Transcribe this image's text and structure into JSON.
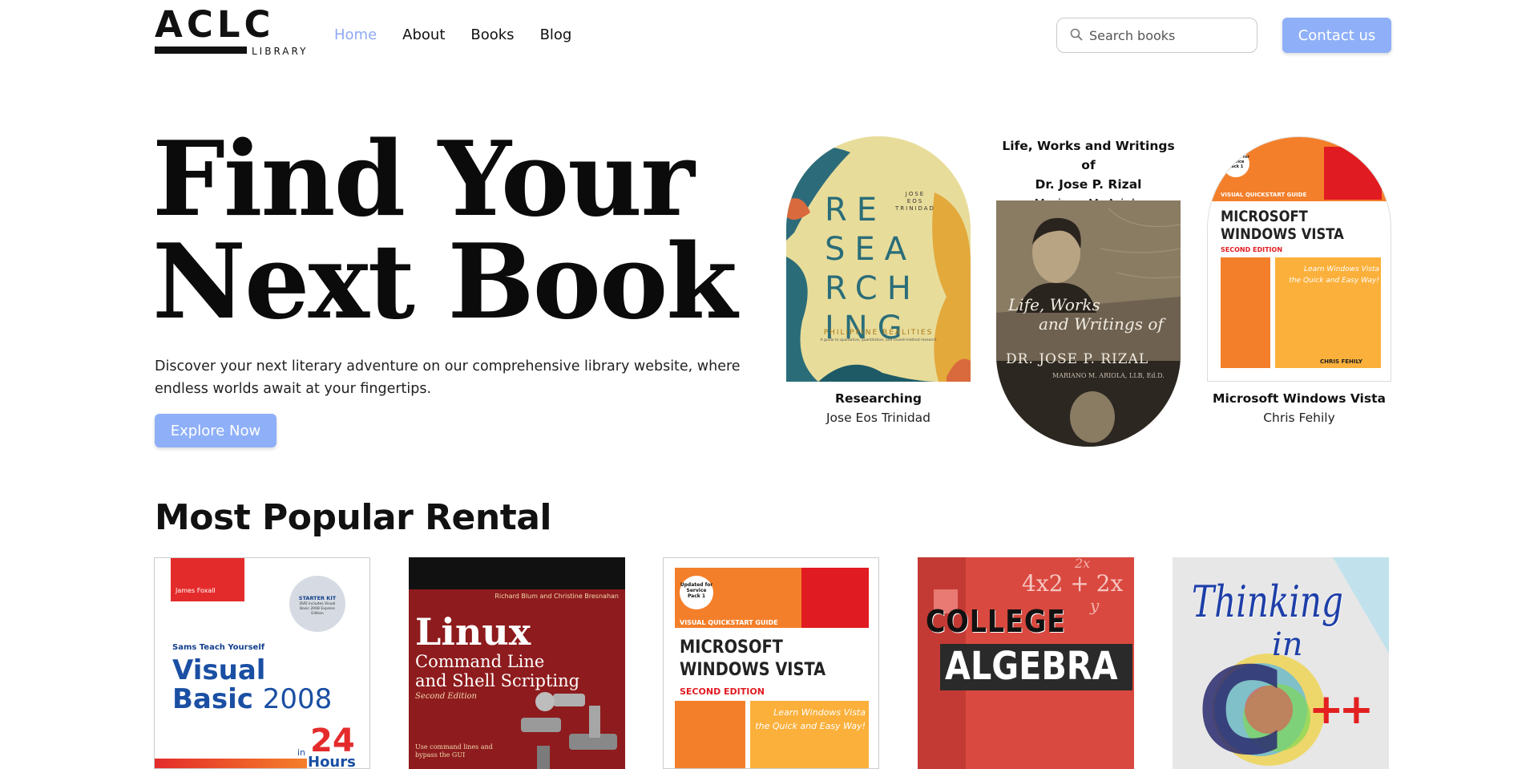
{
  "nav": {
    "logo_main": "ACLC",
    "logo_sub": "LIBRARY",
    "links": [
      {
        "label": "Home",
        "active": true
      },
      {
        "label": "About",
        "active": false
      },
      {
        "label": "Books",
        "active": false
      },
      {
        "label": "Blog",
        "active": false
      }
    ],
    "search_placeholder": "Search books",
    "contact_label": "Contact us"
  },
  "colors": {
    "accent": "#8fb0f8",
    "active_link": "#8fa9f5"
  },
  "hero": {
    "title_line1": "Find Your",
    "title_line2": "Next Book",
    "description": "Discover your next literary adventure on our comprehensive library website, where endless worlds await at your fingertips.",
    "cta_label": "Explore Now"
  },
  "featured": [
    {
      "title": "Researching",
      "author": "Jose Eos Trinidad",
      "cover": {
        "author_line1": "JOSE",
        "author_line2": "EOS",
        "author_line3": "TRINIDAD",
        "rows": [
          "RE",
          "SEA",
          "RCH",
          "ING"
        ],
        "sub": "PHILIPPINE REALITIES",
        "tagline": "A guide to qualitative, quantitative, and mixed-method research"
      }
    },
    {
      "title_line1": "Life, Works and Writings of",
      "title_line2": "Dr. Jose P. Rizal",
      "author": "Mariano M. Ariola",
      "cover": {
        "line1": "Life, Works",
        "line2": "and Writings of",
        "line3": "DR. JOSE P. RIZAL",
        "line4": "MARIANO M. ARIOLA, LLB, Ed.D."
      }
    },
    {
      "title": "Microsoft Windows Vista",
      "author": "Chris Fehily",
      "cover": {
        "badge": "Updated for Service Pack 1",
        "series": "VISUAL QUICKSTART GUIDE",
        "line1": "MICROSOFT",
        "line2": "WINDOWS VISTA",
        "edition": "SECOND EDITION",
        "blurb1": "Learn Windows Vista",
        "blurb2": "the Quick and Easy Way!",
        "author": "CHRIS FEHILY"
      }
    }
  ],
  "popular": {
    "heading": "Most Popular Rental",
    "books": [
      {
        "name": "visual-basic",
        "author": "James Foxall",
        "kit": "STARTER KIT",
        "kit_sub": "DVD includes Visual Basic 2008 Express Edition",
        "series": "Sams Teach Yourself",
        "line1": "Visual",
        "line2": "Basic",
        "year": "2008",
        "in": "in",
        "num": "24",
        "hours": "Hours"
      },
      {
        "name": "linux",
        "author": "Richard Blum and Christine Bresnahan",
        "line1": "Linux",
        "line2": "Command Line",
        "line3": "and Shell Scripting",
        "edition": "Second Edition",
        "tag1": "Use command lines and",
        "tag2": "bypass the GUI"
      },
      {
        "name": "windows-vista",
        "badge": "Updated for Service Pack 1",
        "series": "VISUAL QUICKSTART GUIDE",
        "line1": "MICROSOFT",
        "line2": "WINDOWS VISTA",
        "edition": "SECOND EDITION",
        "blurb1": "Learn Windows Vista",
        "blurb2": "the Quick and Easy Way!"
      },
      {
        "name": "college-algebra",
        "eq1": "2x",
        "eq2": "4x2 + 2x",
        "eq3": "y",
        "line1": "COLLEGE",
        "line2": "ALGEBRA"
      },
      {
        "name": "thinking-in-cpp",
        "line1": "Thinking",
        "line2": "in",
        "letter": "C",
        "plus": "++"
      }
    ]
  }
}
